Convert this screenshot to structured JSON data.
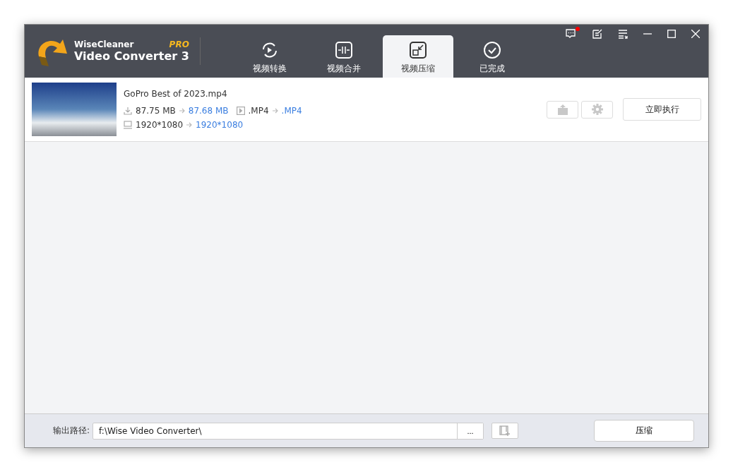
{
  "app": {
    "brand": "WiseCleaner",
    "product": "Video Converter 3",
    "edition": "PRO"
  },
  "title_buttons": {
    "notifications_unread": true
  },
  "tabs": [
    {
      "label": "视频转换",
      "kind": "convert",
      "selected": false
    },
    {
      "label": "视频合并",
      "kind": "merge",
      "selected": false
    },
    {
      "label": "视频压缩",
      "kind": "compress",
      "selected": true
    },
    {
      "label": "已完成",
      "kind": "done",
      "selected": false
    }
  ],
  "files": [
    {
      "name": "GoPro Best of 2023.mp4",
      "size_from": "87.75 MB",
      "size_to": "87.68 MB",
      "format_from": ".MP4",
      "format_to": ".MP4",
      "resolution_from": "1920*1080",
      "resolution_to": "1920*1080",
      "run_label": "立即执行"
    }
  ],
  "footer": {
    "path_label": "输出路径:",
    "path_value": "f:\\Wise Video Converter\\",
    "browse_label": "...",
    "action_label": "压缩"
  }
}
